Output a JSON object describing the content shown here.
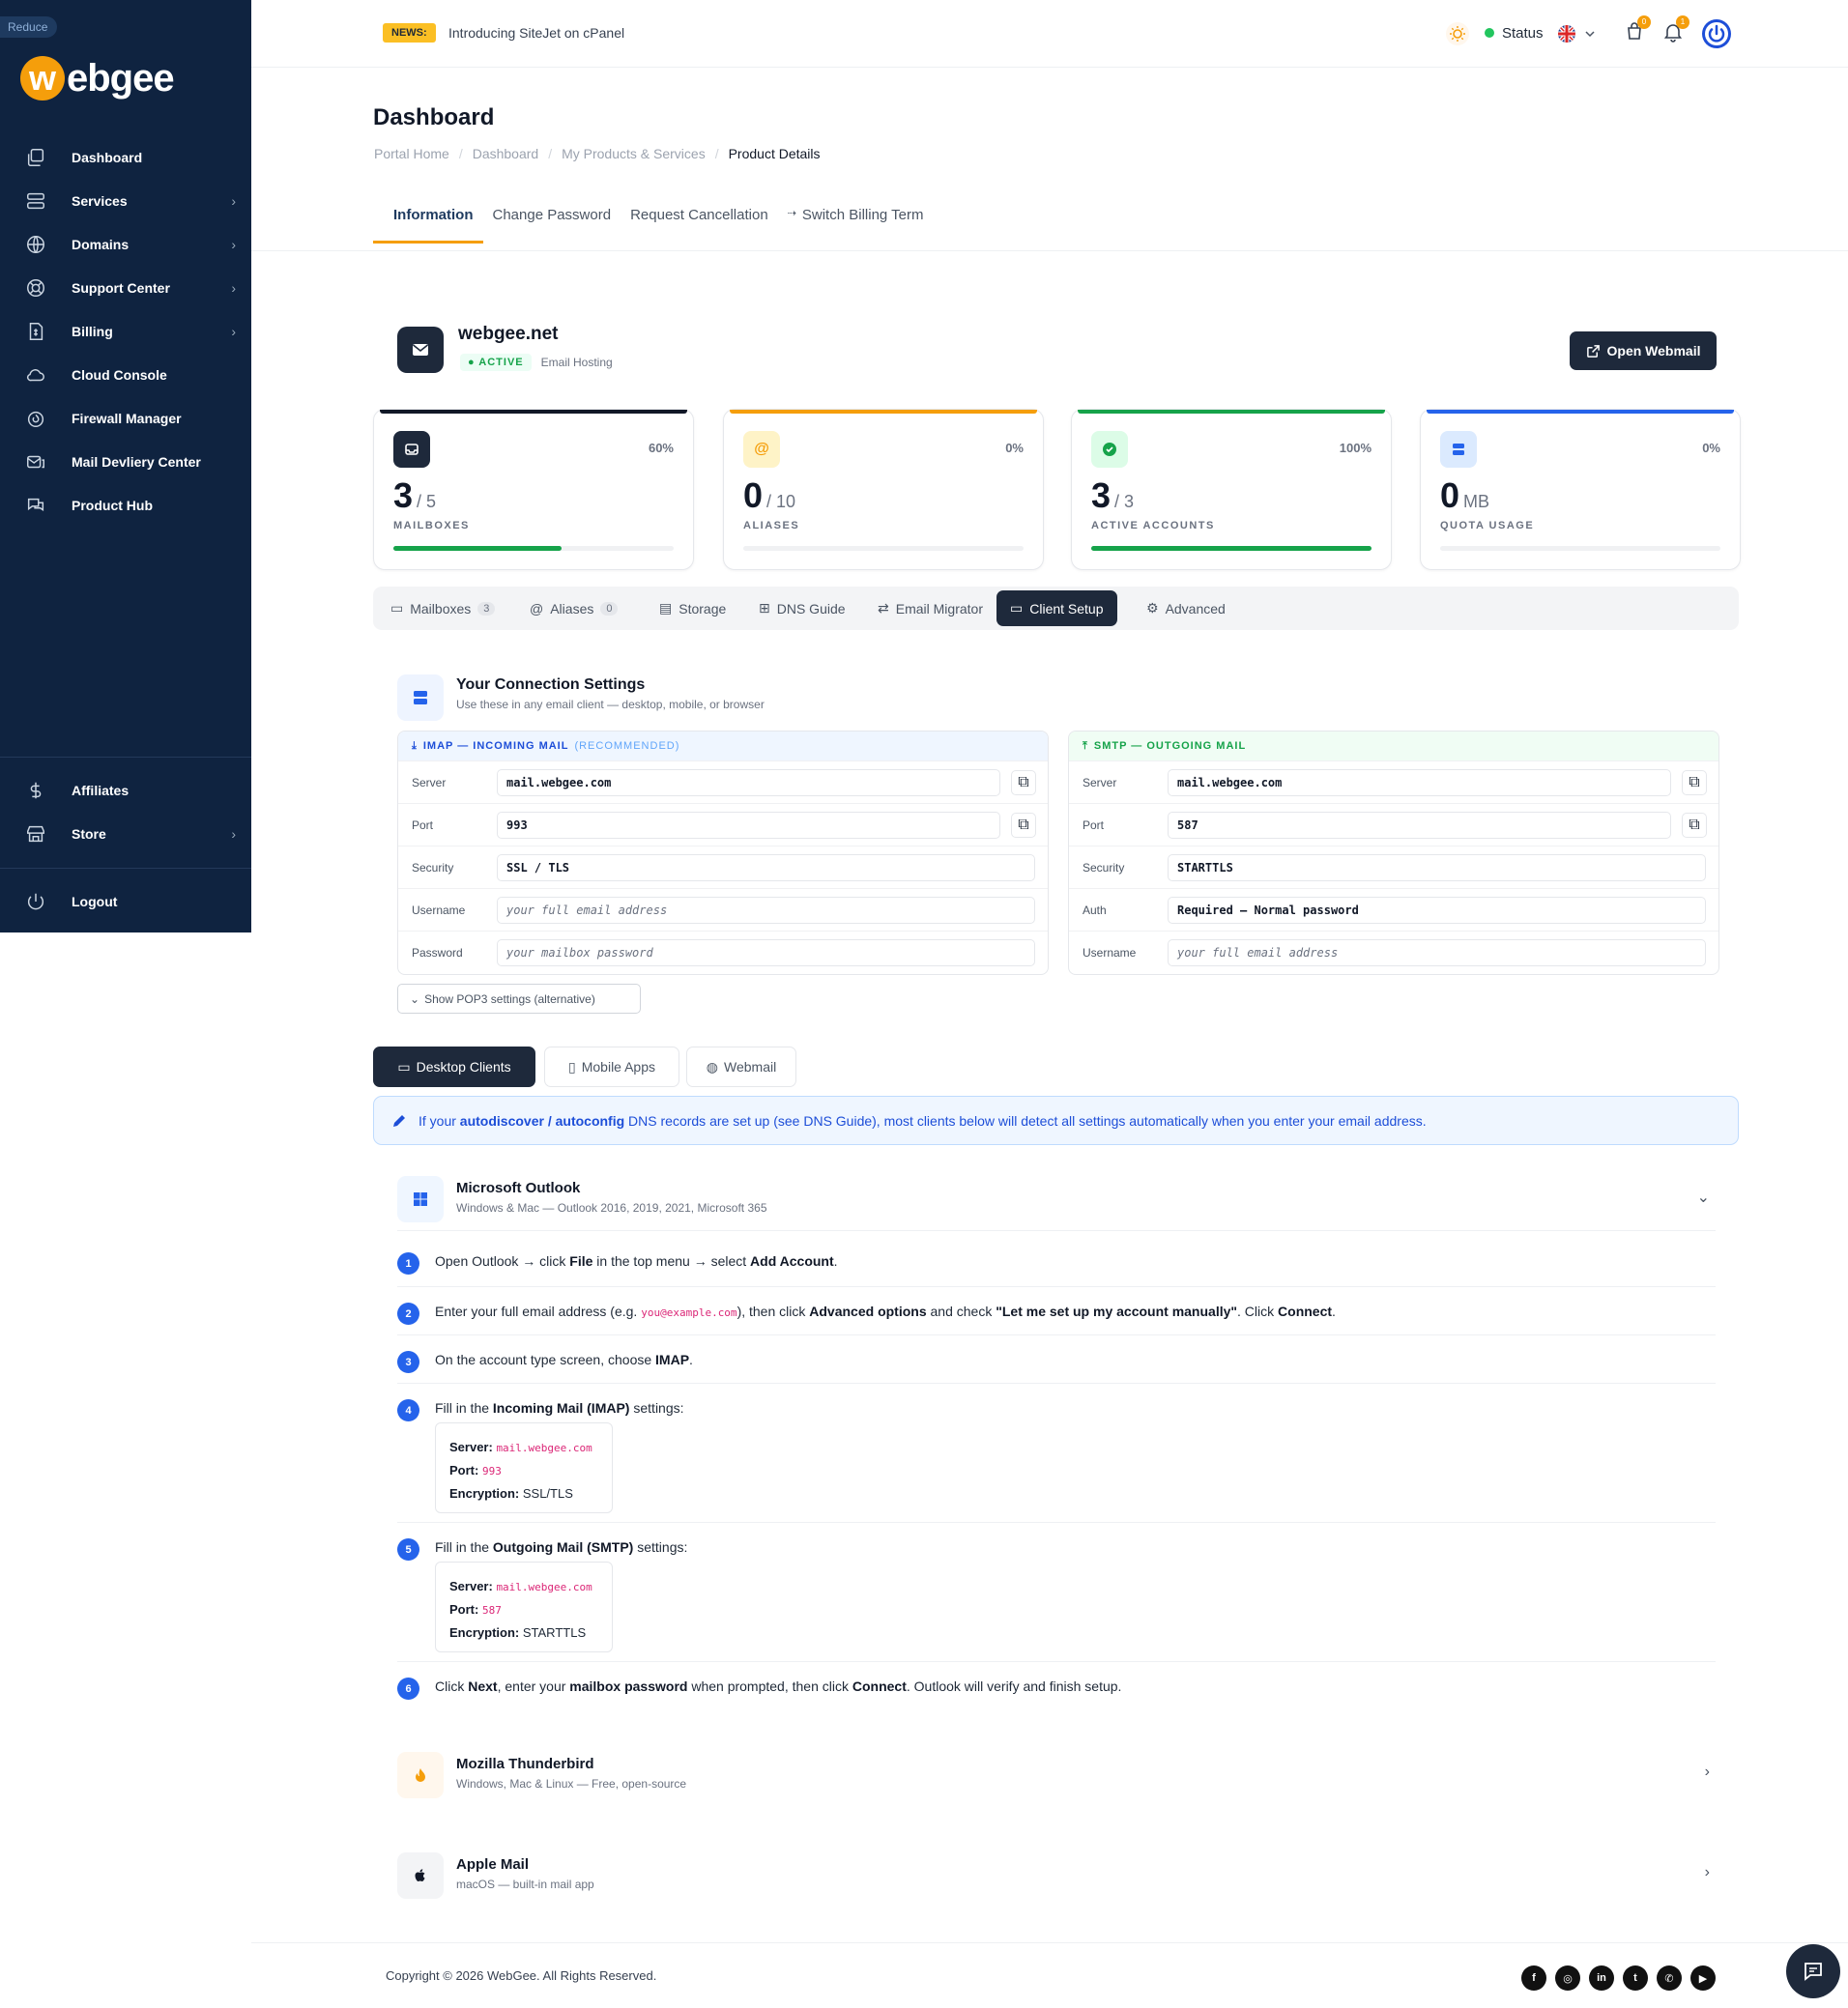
{
  "sidebar": {
    "reduce_label": "Reduce",
    "logo_w": "w",
    "logo_text": "ebgee",
    "items": [
      {
        "label": "Dashboard",
        "icon": "dashboard-icon",
        "has_children": false
      },
      {
        "label": "Services",
        "icon": "services-icon",
        "has_children": true
      },
      {
        "label": "Domains",
        "icon": "globe-icon",
        "has_children": true
      },
      {
        "label": "Support Center",
        "icon": "support-icon",
        "has_children": true
      },
      {
        "label": "Billing",
        "icon": "billing-icon",
        "has_children": true
      },
      {
        "label": "Cloud Console",
        "icon": "cloud-icon",
        "has_children": false
      },
      {
        "label": "Firewall Manager",
        "icon": "firewall-icon",
        "has_children": false
      },
      {
        "label": "Mail Devliery Center",
        "icon": "mail-icon",
        "has_children": false
      },
      {
        "label": "Product Hub",
        "icon": "chat-icon",
        "has_children": false
      }
    ],
    "affiliates_label": "Affiliates",
    "store_label": "Store",
    "logout_label": "Logout"
  },
  "topbar": {
    "news_label": "NEWS:",
    "news_text": "Introducing SiteJet on cPanel",
    "status_label": "Status",
    "cart_badge": "0",
    "notif_badge": "1"
  },
  "page": {
    "title": "Dashboard",
    "breadcrumbs": [
      "Portal Home",
      "Dashboard",
      "My Products & Services",
      "Product Details"
    ],
    "tabs": [
      "Information",
      "Change Password",
      "Request Cancellation",
      "Switch Billing Term"
    ]
  },
  "product": {
    "name": "webgee.net",
    "status": "ACTIVE",
    "type": "Email Hosting",
    "webmail_label": "Open Webmail"
  },
  "stats": [
    {
      "value": "3",
      "total": "/ 5",
      "label": "MAILBOXES",
      "percent": "60%",
      "fill": 0.6,
      "color": "#111827",
      "fill_color": "#16a34a",
      "icon": "inbox-icon"
    },
    {
      "value": "0",
      "total": "/ 10",
      "label": "ALIASES",
      "percent": "0%",
      "fill": 0,
      "color": "#f59e0b",
      "fill_color": "#f59e0b",
      "icon": "at-icon"
    },
    {
      "value": "3",
      "total": "/ 3",
      "label": "ACTIVE ACCOUNTS",
      "percent": "100%",
      "fill": 1.0,
      "color": "#16a34a",
      "fill_color": "#16a34a",
      "icon": "check-circle-icon"
    },
    {
      "value": "0",
      "total": "MB",
      "label": "QUOTA USAGE",
      "percent": "0%",
      "fill": 0,
      "color": "#2563eb",
      "fill_color": "#2563eb",
      "icon": "database-icon"
    }
  ],
  "subtabs": [
    {
      "label": "Mailboxes",
      "count": "3",
      "icon": "inbox-icon"
    },
    {
      "label": "Aliases",
      "count": "0",
      "icon": "at-icon"
    },
    {
      "label": "Storage",
      "count": "",
      "icon": "storage-icon"
    },
    {
      "label": "DNS Guide",
      "count": "",
      "icon": "sitemap-icon"
    },
    {
      "label": "Email Migrator",
      "count": "",
      "icon": "exchange-icon"
    },
    {
      "label": "Client Setup",
      "count": "",
      "icon": "laptop-icon"
    },
    {
      "label": "Advanced",
      "count": "",
      "icon": "gear-icon"
    }
  ],
  "connection": {
    "title": "Your Connection Settings",
    "subtitle": "Use these in any email client — desktop, mobile, or browser",
    "imap": {
      "header": "IMAP — INCOMING MAIL",
      "recommended": "(RECOMMENDED)",
      "rows": [
        {
          "label": "Server",
          "value": "mail.webgee.com",
          "copy": true,
          "placeholder": false
        },
        {
          "label": "Port",
          "value": "993",
          "copy": true,
          "placeholder": false
        },
        {
          "label": "Security",
          "value": "SSL / TLS",
          "copy": false,
          "placeholder": false
        },
        {
          "label": "Username",
          "value": "your full email address",
          "copy": false,
          "placeholder": true
        },
        {
          "label": "Password",
          "value": "your mailbox password",
          "copy": false,
          "placeholder": true
        }
      ]
    },
    "smtp": {
      "header": "SMTP — OUTGOING MAIL",
      "rows": [
        {
          "label": "Server",
          "value": "mail.webgee.com",
          "copy": true,
          "placeholder": false
        },
        {
          "label": "Port",
          "value": "587",
          "copy": true,
          "placeholder": false
        },
        {
          "label": "Security",
          "value": "STARTTLS",
          "copy": false,
          "placeholder": false
        },
        {
          "label": "Auth",
          "value": "Required — Normal password",
          "copy": false,
          "placeholder": false
        },
        {
          "label": "Username",
          "value": "your full email address",
          "copy": false,
          "placeholder": true
        }
      ]
    },
    "pop3_label": "Show POP3 settings (alternative)"
  },
  "client_tabs": [
    "Desktop Clients",
    "Mobile Apps",
    "Webmail"
  ],
  "info": {
    "prefix": "If your",
    "autodiscover": "autodiscover",
    "slash": "/",
    "autoconfig": "autoconfig",
    "suffix": "DNS records are set up (see DNS Guide), most clients below will detect all settings automatically when you enter your email address."
  },
  "outlook": {
    "name": "Microsoft Outlook",
    "sub": "Windows & Mac — Outlook 2016, 2019, 2021, Microsoft 365",
    "steps": {
      "s1": {
        "a": "Open Outlook → click ",
        "b": "File",
        "c": " in the top menu → select ",
        "d": "Add Account",
        "e": "."
      },
      "s2": {
        "a": "Enter your full email address (e.g. ",
        "code": "you@example.com",
        "b": "), then click ",
        "c": "Advanced options",
        "d": " and check ",
        "e": "\"Let me set up my account manually\"",
        "f": ". Click ",
        "g": "Connect",
        "h": "."
      },
      "s3": {
        "a": "On the account type screen, choose ",
        "b": "IMAP",
        "c": "."
      },
      "s4": {
        "a": "Fill in the ",
        "b": "Incoming Mail (IMAP)",
        "c": " settings:",
        "server_l": "Server:",
        "server": "mail.webgee.com",
        "port_l": "Port:",
        "port": "993",
        "enc_l": "Encryption:",
        "enc": "SSL/TLS"
      },
      "s5": {
        "a": "Fill in the ",
        "b": "Outgoing Mail (SMTP)",
        "c": " settings:",
        "server_l": "Server:",
        "server": "mail.webgee.com",
        "port_l": "Port:",
        "port": "587",
        "enc_l": "Encryption:",
        "enc": "STARTTLS"
      },
      "s6": {
        "a": "Click ",
        "b": "Next",
        "c": ", enter your ",
        "d": "mailbox password",
        "e": " when prompted, then click ",
        "f": "Connect",
        "g": ". Outlook will verify and finish setup."
      }
    },
    "nums": [
      "1",
      "2",
      "3",
      "4",
      "5",
      "6"
    ]
  },
  "thunderbird": {
    "name": "Mozilla Thunderbird",
    "sub": "Windows, Mac & Linux — Free, open-source"
  },
  "applemail": {
    "name": "Apple Mail",
    "sub": "macOS — built-in mail app"
  },
  "footer": {
    "copyright": "Copyright © 2026 WebGee. All Rights Reserved."
  }
}
